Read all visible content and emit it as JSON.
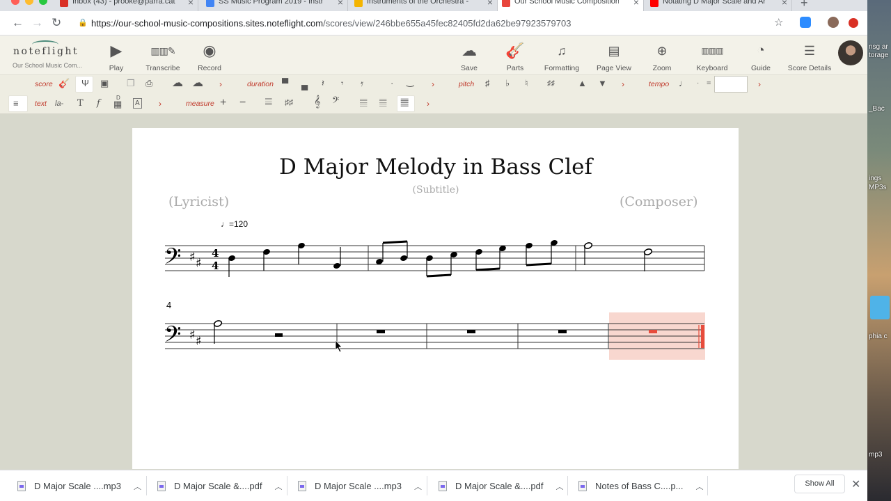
{
  "browser": {
    "tabs": [
      {
        "title": "Inbox (43) - prooke@parra.cat",
        "favicon_color": "#d93025"
      },
      {
        "title": "SS Music Program 2019 - Instr",
        "favicon_color": "#4285f4"
      },
      {
        "title": "Instruments of the Orchestra -",
        "favicon_color": "#f4b400"
      },
      {
        "title": "Our School Music Composition",
        "favicon_color": "#e8453c",
        "active": true
      },
      {
        "title": "Notating D Major Scale and Ar",
        "favicon_color": "#ff0000"
      }
    ],
    "new_tab": "+",
    "url_main": "https://our-school-music-compositions.sites.noteflight.com",
    "url_path": "/scores/view/246bbe655a45fec82405fd2da62be97923579703"
  },
  "app": {
    "logo": "noteflight",
    "logo_sub": "Our School Music Com...",
    "tools_left": [
      {
        "label": "Play",
        "icon": "play-icon"
      },
      {
        "label": "Transcribe",
        "icon": "keyboard-pen-icon"
      },
      {
        "label": "Record",
        "icon": "record-icon"
      }
    ],
    "tools_right": [
      {
        "label": "Save",
        "icon": "cloud-icon"
      },
      {
        "label": "Parts",
        "icon": "guitar-icon"
      },
      {
        "label": "Formatting",
        "icon": "formatting-icon"
      },
      {
        "label": "Page View",
        "icon": "page-icon"
      },
      {
        "label": "Zoom",
        "icon": "zoom-icon"
      },
      {
        "label": "Keyboard",
        "icon": "keyboard-icon"
      },
      {
        "label": "Guide",
        "icon": "compass-icon"
      },
      {
        "label": "Score Details",
        "icon": "list-icon"
      }
    ]
  },
  "palette": {
    "score": "score",
    "duration": "duration",
    "pitch": "pitch",
    "tempo": "tempo",
    "text": "text",
    "measure": "measure",
    "lyric_symbol": "la-",
    "text_symbol": "T",
    "dynamic_symbol": "f",
    "chord_symbol": "D",
    "box_symbol": "A",
    "tempo_equals": "=",
    "tempo_value": ""
  },
  "score": {
    "title": "D Major Melody in Bass Clef",
    "subtitle": "(Subtitle)",
    "lyricist": "(Lyricist)",
    "composer": "(Composer)",
    "tempo_marking": "=120",
    "measure_number": "4",
    "time_signature": "4/4",
    "key_signature": "D major",
    "clef": "bass"
  },
  "downloads": {
    "items": [
      {
        "name": "D Major Scale ....mp3"
      },
      {
        "name": "D Major Scale &....pdf"
      },
      {
        "name": "D Major Scale ....mp3"
      },
      {
        "name": "D Major Scale &....pdf"
      },
      {
        "name": "Notes of Bass C....p..."
      }
    ],
    "show_all": "Show All"
  },
  "desktop": {
    "labels": [
      "nsg ar",
      "torage",
      "_Bac",
      "ings",
      "MP3s",
      "phia c",
      "mp3"
    ]
  },
  "colors": {
    "accent_red": "#c0392b",
    "selection_pink": "#f8d7cf",
    "cursor_red": "#e74c3c"
  }
}
